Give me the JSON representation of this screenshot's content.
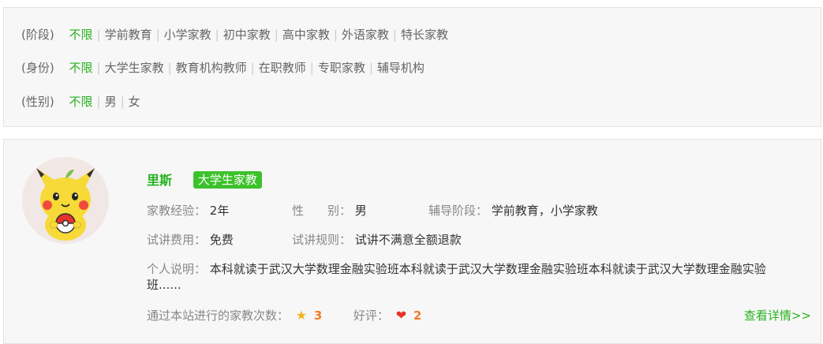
{
  "filters": {
    "stage": {
      "label": "(阶段)",
      "options": [
        "不限",
        "学前教育",
        "小学家教",
        "初中家教",
        "高中家教",
        "外语家教",
        "特长家教"
      ]
    },
    "identity": {
      "label": "(身份)",
      "options": [
        "不限",
        "大学生家教",
        "教育机构教师",
        "在职教师",
        "专职家教",
        "辅导机构"
      ]
    },
    "gender": {
      "label": "(性别)",
      "options": [
        "不限",
        "男",
        "女"
      ]
    },
    "separator": "|",
    "active_color": "#27b11f"
  },
  "tutor": {
    "name": "里斯",
    "tag": "大学生家教",
    "experience_label": "家教经验：",
    "experience_value": "2年",
    "gender_label": "性　　别：",
    "gender_value": "男",
    "stage_label": "辅导阶段：",
    "stage_value": "学前教育，小学家教",
    "fee_label": "试讲费用：",
    "fee_value": "免费",
    "rule_label": "试讲规则：",
    "rule_value": "试讲不满意全额退款",
    "intro_label": "个人说明：",
    "intro_value": "本科就读于武汉大学数理金融实验班本科就读于武汉大学数理金融实验班本科就读于武汉大学数理金融实验班......",
    "count_label": "通过本站进行的家教次数：",
    "count_value": "3",
    "review_label": "好评：",
    "review_value": "2",
    "detail_link": "查看详情>>",
    "avatar_icon": "pikachu-avatar-icon"
  }
}
